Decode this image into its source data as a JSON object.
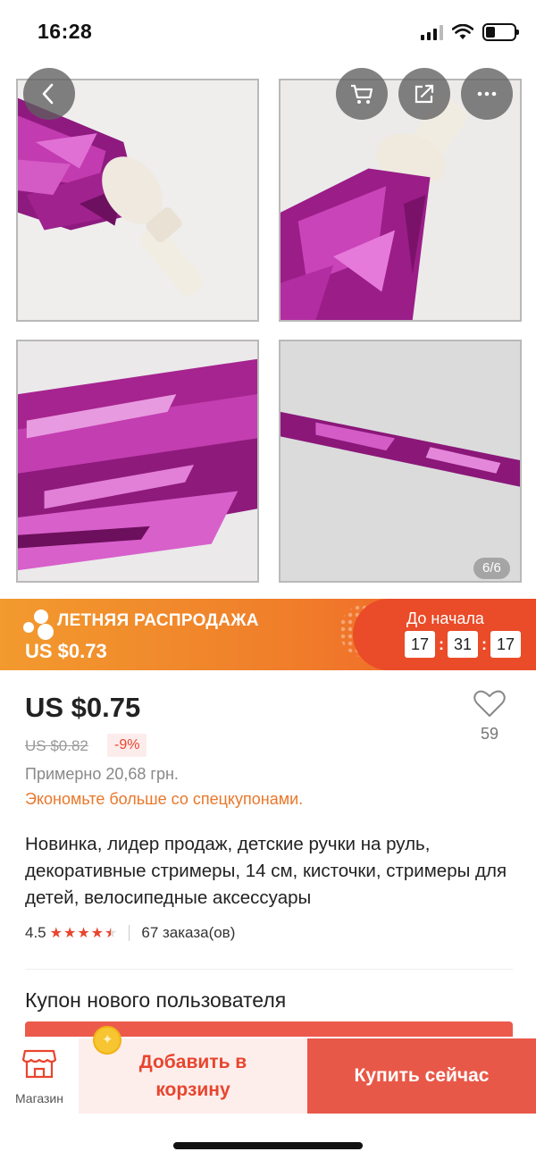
{
  "status_bar": {
    "time": "16:28",
    "battery_level": 0.34
  },
  "gallery": {
    "pager": "6/6",
    "icons": [
      "back-icon",
      "cart-icon",
      "share-icon",
      "more-icon"
    ],
    "images": [
      "tassel-handle-photo",
      "tassel-handle-closeup-photo",
      "tinsel-streamers-photo",
      "tinsel-strip-photo"
    ]
  },
  "banner": {
    "title": "ЛЕТНЯЯ РАСПРОДАЖА",
    "price": "US $0.73",
    "countdown_label": "До начала",
    "hours": "17",
    "minutes": "31",
    "seconds": "17"
  },
  "product": {
    "price": "US $0.75",
    "wishlist_count": "59",
    "old_price": "US $0.82",
    "discount": "-9%",
    "approx_price": "Примерно 20,68 грн.",
    "coupon_promo": "Экономьте больше со спецкупонами.",
    "title": "Новинка, лидер продаж, детские ручки на руль, декоративные стримеры, 14 см, кисточки, стримеры для детей, велосипедные аксессуары",
    "rating": "4.5",
    "rating_stars": 4.5,
    "orders": "67 заказа(ов)"
  },
  "coupon_section": {
    "title": "Купон нового пользователя"
  },
  "bottom_bar": {
    "store_label": "Магазин",
    "add_to_cart": "Добавить в корзину",
    "buy_now": "Купить сейчас"
  },
  "colors": {
    "accent": "#e8452e",
    "banner_orange": "#f29a2e",
    "promo_orange": "#e9772a",
    "tinsel_magenta": "#b0239b"
  }
}
